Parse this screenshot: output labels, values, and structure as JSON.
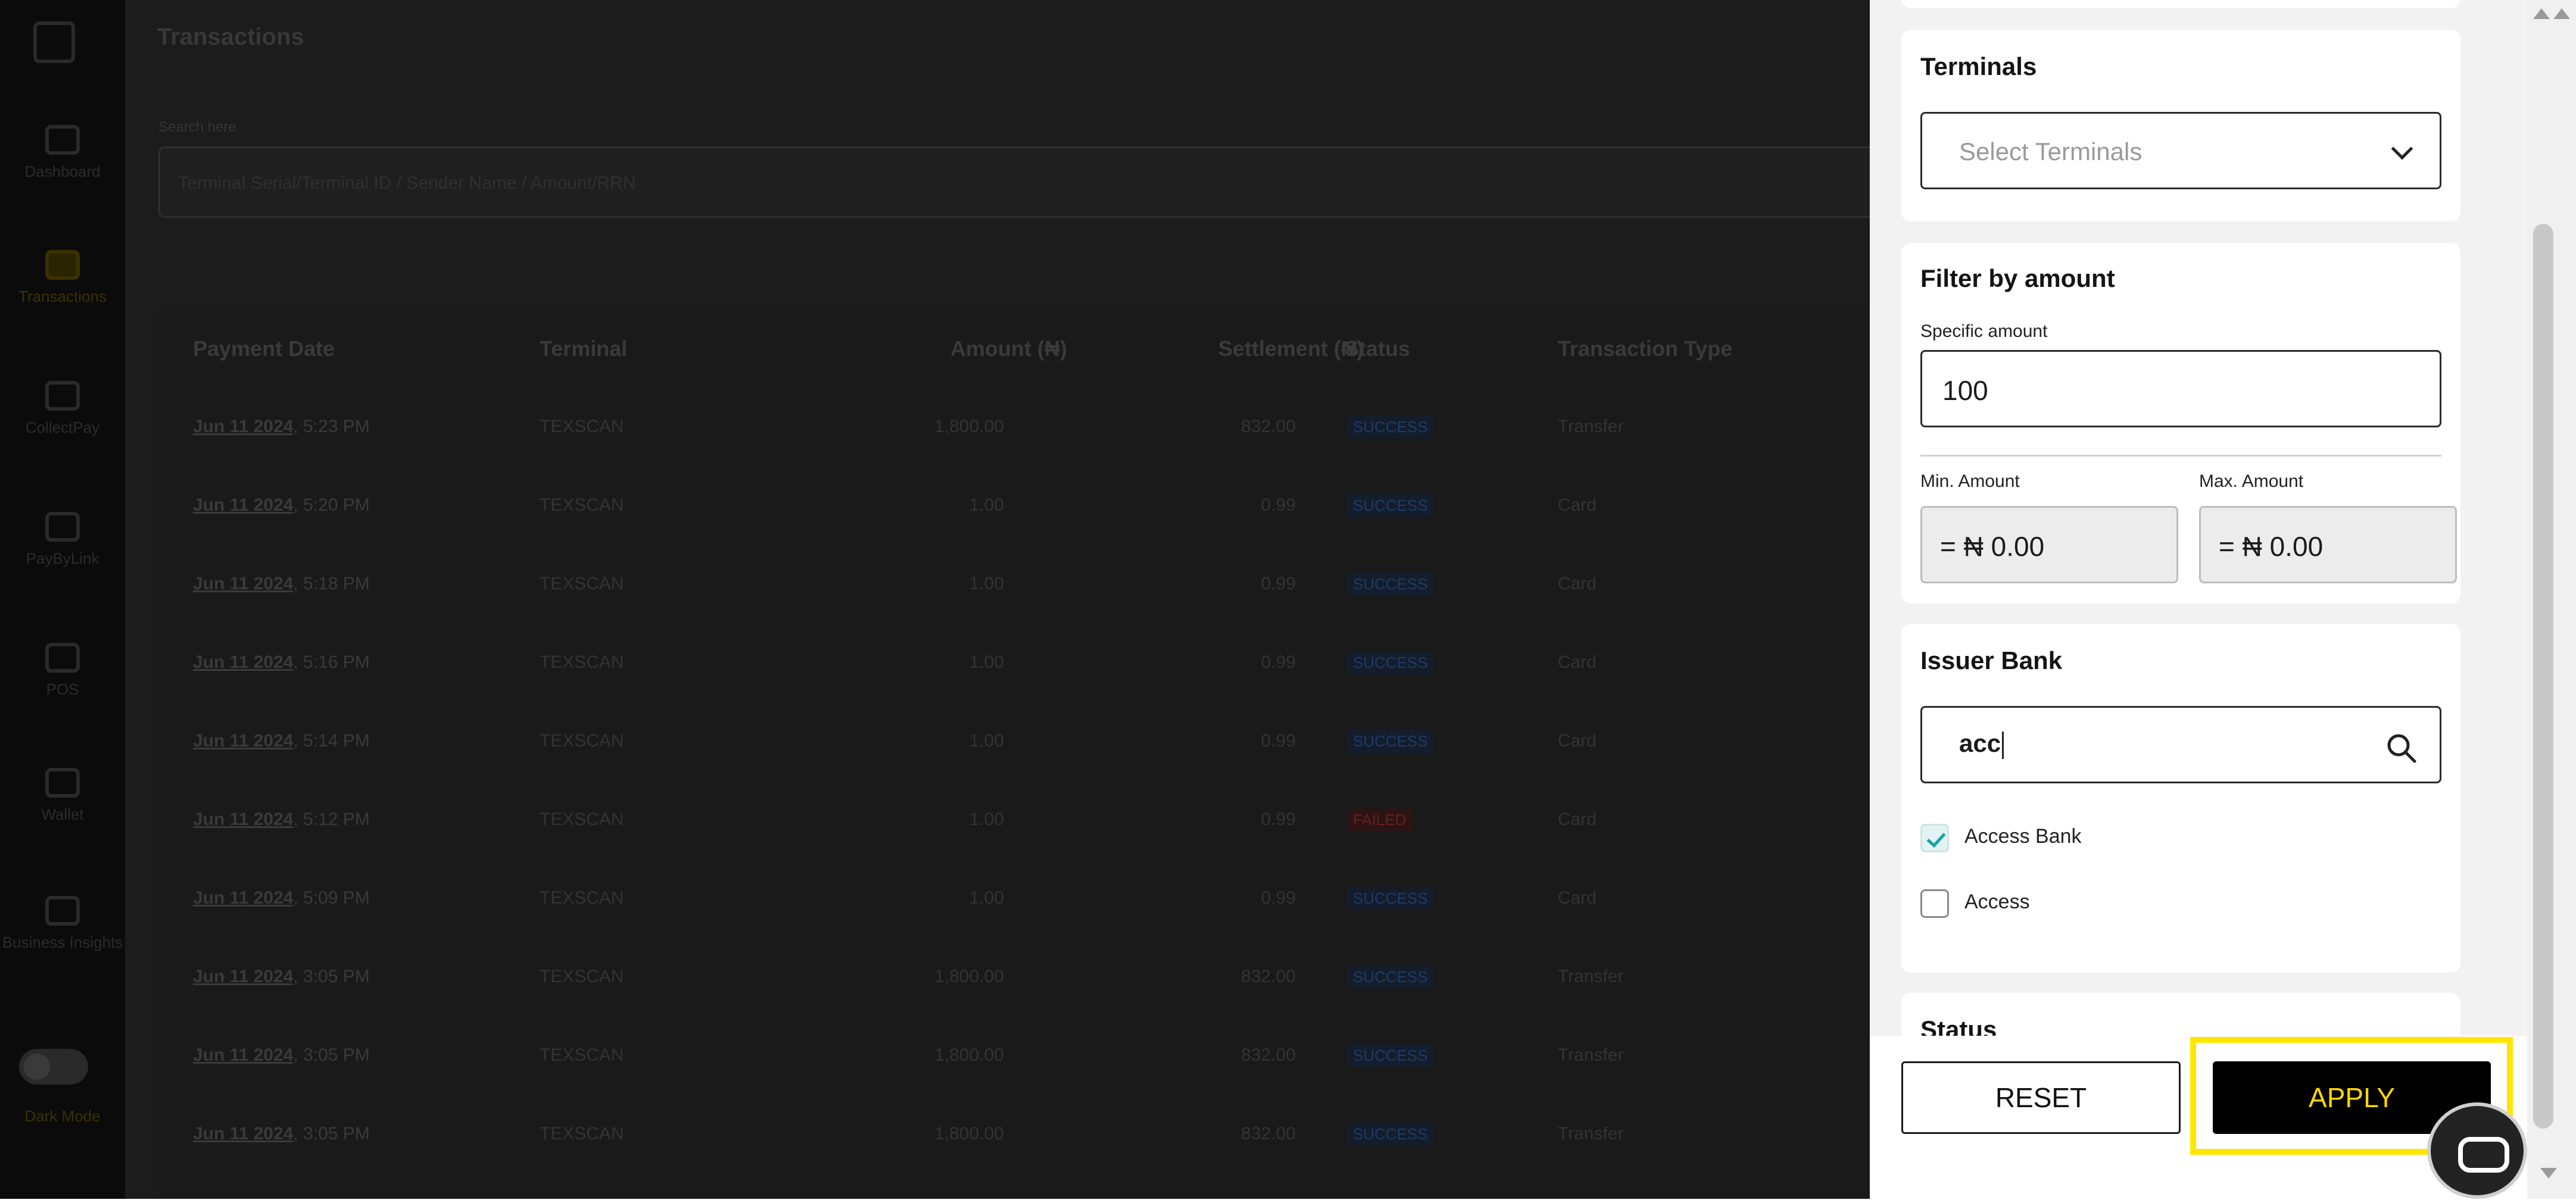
{
  "app": {
    "title": "Transactions",
    "sidebar": [
      {
        "label": "Dashboard",
        "icon": "grid-icon"
      },
      {
        "label": "Transactions",
        "icon": "money-icon",
        "active": true
      },
      {
        "label": "CollectPay",
        "icon": "clock-icon"
      },
      {
        "label": "PayByLink",
        "icon": "card-icon"
      },
      {
        "label": "POS",
        "icon": "pos-icon"
      },
      {
        "label": "Wallet",
        "icon": "wallet-icon"
      },
      {
        "label": "Business Insights",
        "icon": "insights-icon"
      }
    ],
    "dark_mode_label": "Dark Mode",
    "search": {
      "label": "Search here",
      "placeholder": "Terminal Serial/Terminal ID / Sender Name / Amount/RRN"
    },
    "table": {
      "headers": [
        "Payment Date",
        "Terminal",
        "Amount (₦)",
        "Settlement (₦)",
        "Status",
        "Transaction Type"
      ],
      "rows": [
        {
          "date": "Jun 11 2024",
          "time": ", 5:23 PM",
          "terminal": "TEXSCAN",
          "amount": "1,800.00",
          "settlement": "832.00",
          "status": "SUCCESS",
          "type": "Transfer"
        },
        {
          "date": "Jun 11 2024",
          "time": ", 5:20 PM",
          "terminal": "TEXSCAN",
          "amount": "1.00",
          "settlement": "0.99",
          "status": "SUCCESS",
          "type": "Card"
        },
        {
          "date": "Jun 11 2024",
          "time": ", 5:18 PM",
          "terminal": "TEXSCAN",
          "amount": "1.00",
          "settlement": "0.99",
          "status": "SUCCESS",
          "type": "Card"
        },
        {
          "date": "Jun 11 2024",
          "time": ", 5:16 PM",
          "terminal": "TEXSCAN",
          "amount": "1.00",
          "settlement": "0.99",
          "status": "SUCCESS",
          "type": "Card"
        },
        {
          "date": "Jun 11 2024",
          "time": ", 5:14 PM",
          "terminal": "TEXSCAN",
          "amount": "1.00",
          "settlement": "0.99",
          "status": "SUCCESS",
          "type": "Card"
        },
        {
          "date": "Jun 11 2024",
          "time": ", 5:12 PM",
          "terminal": "TEXSCAN",
          "amount": "1.00",
          "settlement": "0.99",
          "status": "FAILED",
          "type": "Card"
        },
        {
          "date": "Jun 11 2024",
          "time": ", 5:09 PM",
          "terminal": "TEXSCAN",
          "amount": "1.00",
          "settlement": "0.99",
          "status": "SUCCESS",
          "type": "Card"
        },
        {
          "date": "Jun 11 2024",
          "time": ", 3:05 PM",
          "terminal": "TEXSCAN",
          "amount": "1,800.00",
          "settlement": "832.00",
          "status": "SUCCESS",
          "type": "Transfer"
        },
        {
          "date": "Jun 11 2024",
          "time": ", 3:05 PM",
          "terminal": "TEXSCAN",
          "amount": "1,800.00",
          "settlement": "832.00",
          "status": "SUCCESS",
          "type": "Transfer"
        },
        {
          "date": "Jun 11 2024",
          "time": ", 3:05 PM",
          "terminal": "TEXSCAN",
          "amount": "1,800.00",
          "settlement": "832.00",
          "status": "SUCCESS",
          "type": "Transfer"
        }
      ]
    }
  },
  "filter": {
    "terminals": {
      "title": "Terminals",
      "placeholder": "Select Terminals"
    },
    "amount": {
      "title": "Filter by amount",
      "specific_label": "Specific amount",
      "specific_value": "100",
      "min_label": "Min. Amount",
      "min_value": "= ₦ 0.00",
      "max_label": "Max. Amount",
      "max_value": "= ₦ 0.00"
    },
    "issuer_bank": {
      "title": "Issuer Bank",
      "search_value": "acc",
      "options": [
        {
          "label": "Access Bank",
          "checked": true
        },
        {
          "label": "Access",
          "checked": false
        }
      ]
    },
    "status": {
      "title": "Status"
    },
    "reset_label": "RESET",
    "apply_label": "APPLY"
  },
  "colors": {
    "accent": "#ffd700",
    "highlight": "#ffe600",
    "check": "#16a3a3",
    "overlay": "#1c1c1c"
  }
}
